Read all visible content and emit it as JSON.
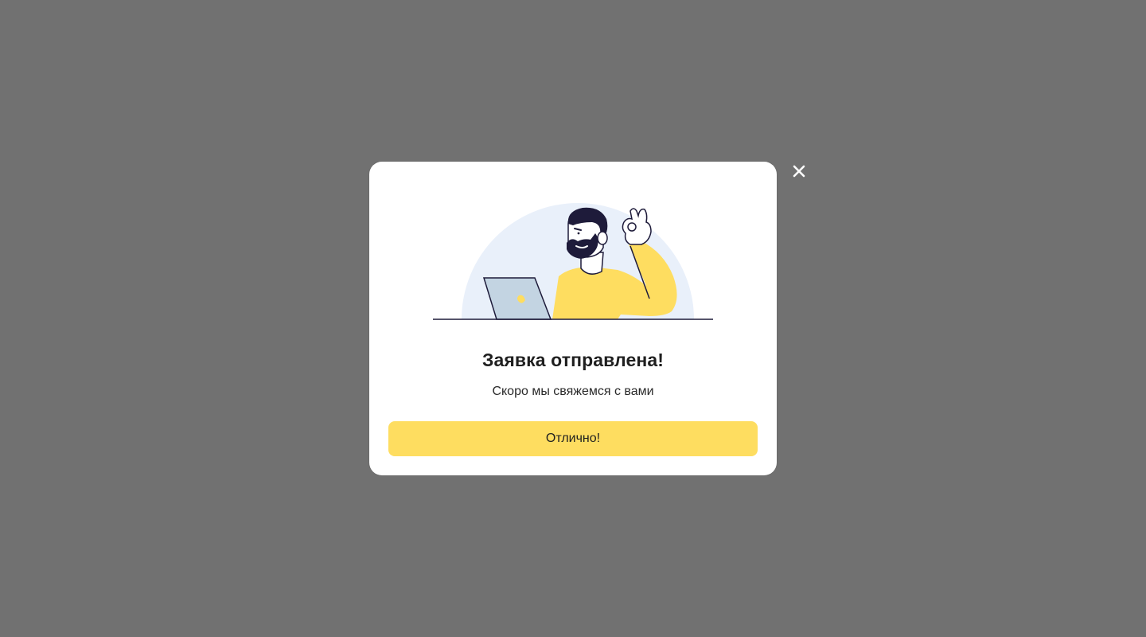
{
  "modal": {
    "title": "Заявка отправлена!",
    "subtitle": "Скоро мы свяжемся с вами",
    "ok_label": "Отлично!",
    "close_icon": "close-icon",
    "illustration_icon": "person-with-laptop-ok-gesture-illustration"
  },
  "colors": {
    "overlay": "#717171",
    "modal_bg": "#ffffff",
    "accent": "#fedd60",
    "illustration_circle": "#e9f0fa",
    "illustration_shirt": "#fedd60",
    "illustration_laptop": "#c3d4e2",
    "illustration_outline": "#1e1b3a"
  }
}
